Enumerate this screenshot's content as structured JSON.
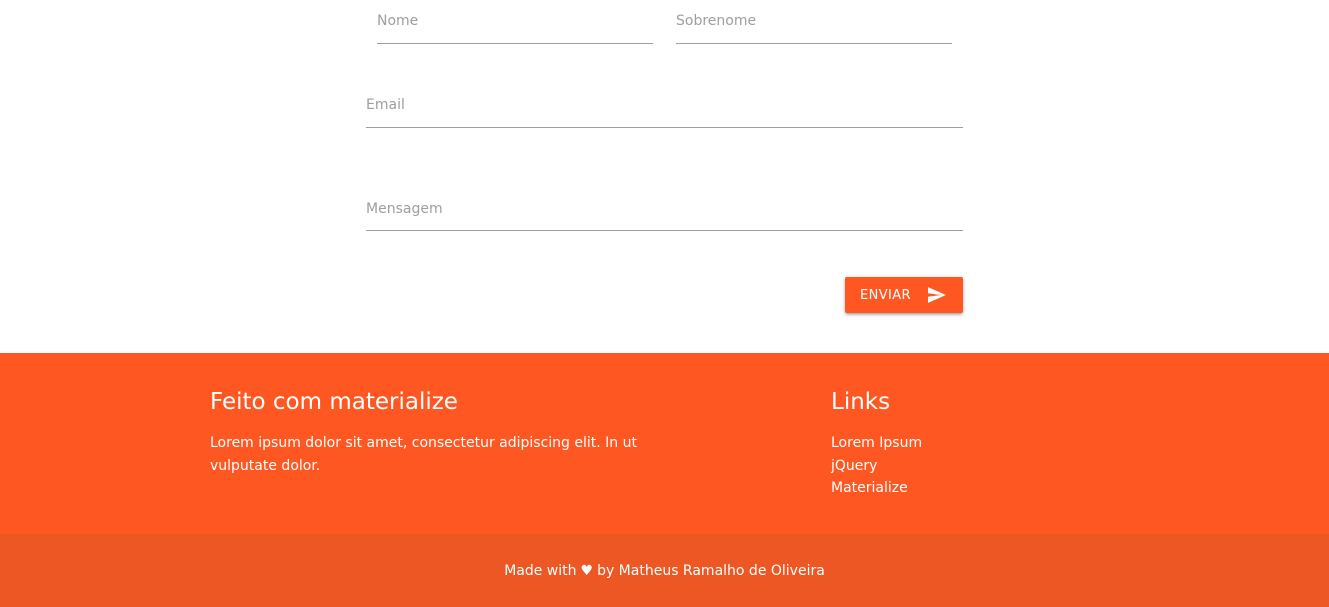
{
  "form": {
    "first_name_placeholder": "Nome",
    "last_name_placeholder": "Sobrenome",
    "email_placeholder": "Email",
    "message_placeholder": "Mensagem",
    "send_label": "ENVIAR"
  },
  "footer": {
    "title": "Feito com materialize",
    "text": "Lorem ipsum dolor sit amet, consectetur adipiscing elit. In ut vulputate dolor.",
    "links_title": "Links",
    "links": [
      "Lorem Ipsum",
      "jQuery",
      "Materialize"
    ]
  },
  "copyright": {
    "prefix": "Made with",
    "heart": "♥",
    "suffix": "by Matheus Ramalho de Oliveira"
  },
  "colors": {
    "accent": "#ff5722",
    "copyright_bg": "#ed5724",
    "input_line": "#9e9e9e"
  }
}
